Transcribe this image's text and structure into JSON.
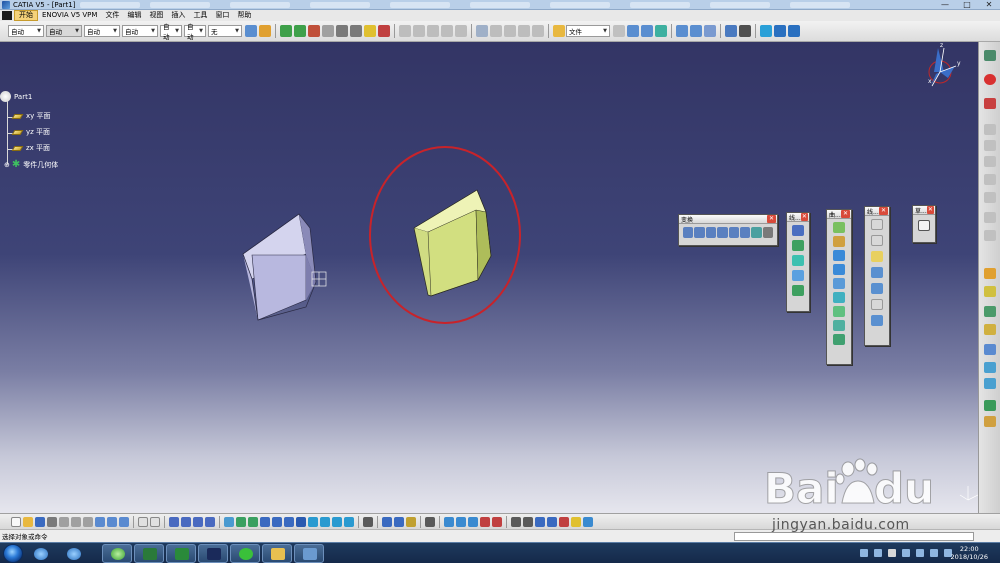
{
  "window": {
    "title": "CATIA V5 - [Part1]",
    "controls": [
      "—",
      "□",
      "✕"
    ]
  },
  "menubar": {
    "items": [
      "开始",
      "ENOVIA V5 VPM",
      "文件",
      "编辑",
      "视图",
      "插入",
      "工具",
      "窗口",
      "帮助"
    ]
  },
  "toolbar": {
    "combos": [
      {
        "value": "自动"
      },
      {
        "value": "自动"
      },
      {
        "value": "自动"
      },
      {
        "value": "自动"
      },
      {
        "value": "自动"
      },
      {
        "value": "自动"
      },
      {
        "value": "无"
      }
    ],
    "file_combo": "文件"
  },
  "tree": {
    "root": "Part1",
    "children": [
      "xy 平面",
      "yz 平面",
      "zx 平面",
      "零件几何体"
    ]
  },
  "panels": {
    "transform_title": "变换",
    "ref_title": "线...",
    "surf_title": "曲...",
    "wire_title": "线...",
    "sketch_title": "草..."
  },
  "compass": {
    "x": "x",
    "y": "y",
    "z": "z"
  },
  "status": {
    "message": "选择对象或命令"
  },
  "taskbar": {
    "time": "22:00",
    "date": "2018/10/26"
  },
  "watermark": {
    "url": "jingyan.baidu.com"
  },
  "colors": {
    "box_left": "#b8b8df",
    "box_right": "#d4e08a",
    "circle": "#c8232a"
  }
}
